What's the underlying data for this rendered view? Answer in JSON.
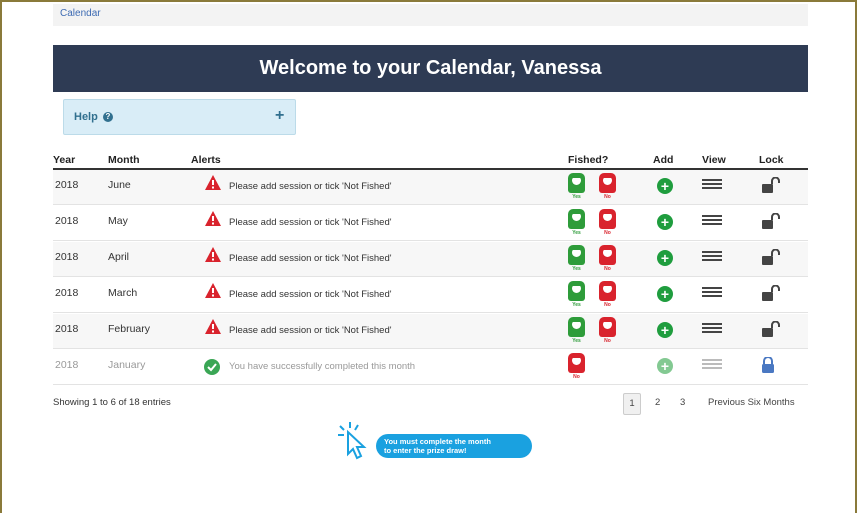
{
  "breadcrumb": "Calendar",
  "banner_title": "Welcome to your Calendar, Vanessa",
  "help": {
    "label": "Help",
    "toggle": "+"
  },
  "table": {
    "headers": {
      "year": "Year",
      "month": "Month",
      "alerts": "Alerts",
      "fished": "Fished?",
      "add": "Add",
      "view": "View",
      "lock": "Lock"
    },
    "fished_yes_label": "Yes",
    "fished_no_label": "No",
    "rows": [
      {
        "year": "2018",
        "month": "June",
        "alert": "Please add session or tick 'Not Fished'",
        "status": "warning",
        "locked": false
      },
      {
        "year": "2018",
        "month": "May",
        "alert": "Please add session or tick 'Not Fished'",
        "status": "warning",
        "locked": false
      },
      {
        "year": "2018",
        "month": "April",
        "alert": "Please add session or tick 'Not Fished'",
        "status": "warning",
        "locked": false
      },
      {
        "year": "2018",
        "month": "March",
        "alert": "Please add session or tick 'Not Fished'",
        "status": "warning",
        "locked": false
      },
      {
        "year": "2018",
        "month": "February",
        "alert": "Please add session or tick 'Not Fished'",
        "status": "warning",
        "locked": false
      },
      {
        "year": "2018",
        "month": "January",
        "alert": "You have successfully completed this month",
        "status": "complete",
        "locked": true
      }
    ]
  },
  "footer": {
    "info": "Showing 1 to 6 of 18 entries",
    "pages": [
      "1",
      "2",
      "3"
    ],
    "active_page": "1",
    "previous": "Previous Six Months"
  },
  "promo": {
    "line1": "You must complete the month",
    "line2": "to enter the prize draw!"
  },
  "colors": {
    "banner": "#2e3b54",
    "help_bg": "#d9edf7",
    "warning": "#d9232d",
    "success": "#1f9d3e",
    "promo": "#1aa1e0"
  }
}
